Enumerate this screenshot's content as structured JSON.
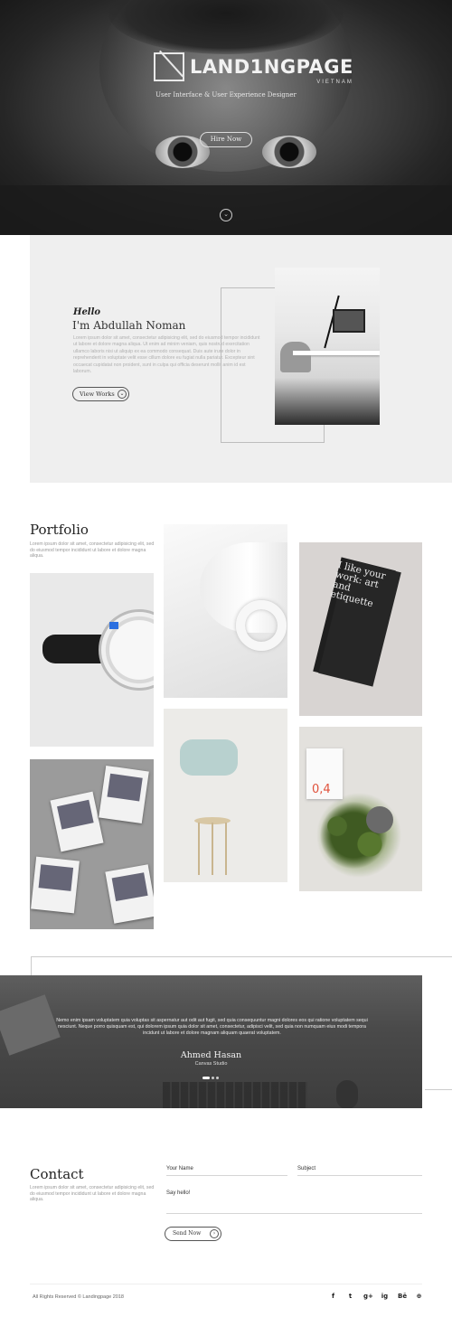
{
  "hero": {
    "logo_text": "LAND1NGPAGE",
    "logo_sub": "VIETNAM",
    "tagline": "User Interface & User Experience Designer",
    "hire_button": "Hire Now",
    "scroll_icon": "chevron-down-icon"
  },
  "about": {
    "hello": "Hello",
    "name": "I'm Abdullah Noman",
    "text": "Lorem ipsum dolor sit amet, consectetur adipisicing elit, sed do eiusmod tempor incididunt ut labore et dolore magna aliqua. Ut enim ad minim veniam, quis nostrud exercitation ullamco laboris nisi ut aliquip ex ea commodo consequat. Duis aute irure dolor in reprehenderit in voluptate velit esse cillum dolore eu fugiat nulla pariatur. Excepteur sint occaecat cupidatat non proident, sunt in culpa qui officia deserunt mollit anim id est laborum.",
    "button": "View Works"
  },
  "portfolio": {
    "title": "Portfolio",
    "text": "Lorem ipsum dolor sit amet, consectetur adipisicing elit, sed do eiusmod tempor incididunt ut labore et dolore magna aliqua.",
    "card_text": "I like your work: art and etiquette",
    "book_number": "0,4"
  },
  "testimonial": {
    "quote": "Nemo enim ipsam voluptatem quia voluptas sit aspernatur aut odit aut fugit, sed quia consequuntur magni dolores eos qui ratione voluptatem sequi nesciunt. Neque porro quisquam est, qui dolorem ipsum quia dolor sit amet, consectetur, adipisci velit, sed quia non numquam eius modi tempora incidunt ut labore et dolore magnam aliquam quaerat voluptatem.",
    "name": "Ahmed Hasan",
    "role": "Canvas Studio"
  },
  "contact": {
    "title": "Contact",
    "text": "Lorem ipsum dolor sit amet, consectetur adipisicing elit, sed do eiusmod tempor incididunt ut labore et dolore magna aliqua.",
    "name_label": "Your Name",
    "subject_label": "Subject",
    "message_placeholder": "Say hello!",
    "send_button": "Send Now"
  },
  "footer": {
    "copyright": "All Rights Reserved © Landingpage 2018",
    "social": [
      "f",
      "t",
      "g+",
      "ig",
      "Bē",
      "⊕"
    ]
  },
  "colors": {
    "hero_dark": "#1b1b1b",
    "about_bg": "#efefef",
    "accent_orange": "#e0523c"
  }
}
